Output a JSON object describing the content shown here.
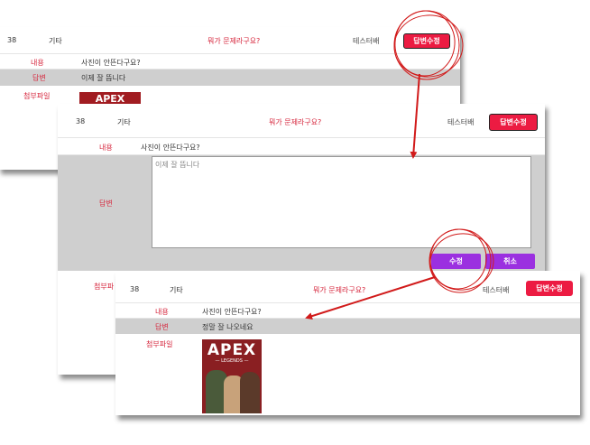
{
  "colors": {
    "accent_red": "#ec1b42",
    "label_red": "#d6243b",
    "submit_purple": "#9b30e0",
    "annotation_red": "#d11a1a"
  },
  "panel1": {
    "num": "38",
    "category": "기타",
    "title": "뭐가 문제라구요?",
    "author": "테스터배",
    "edit_btn": "답변수정",
    "content_label": "내용",
    "content": "사진이 안뜬다구요?",
    "answer_label": "답변",
    "answer": "이제 잘 뜹니다",
    "attach_label": "첨부파일",
    "image_text": "APEX"
  },
  "panel2": {
    "num": "38",
    "category": "기타",
    "title": "뭐가 문제라구요?",
    "author": "테스터배",
    "edit_btn": "답변수정",
    "content_label": "내용",
    "content": "사진이 안뜬다구요?",
    "answer_label": "답변",
    "answer_text": "이제 잘 뜹니다",
    "submit_btn": "수정",
    "cancel_btn": "취소",
    "attach_label": "첨부파"
  },
  "panel3": {
    "num": "38",
    "category": "기타",
    "title": "뭐가 문제라구요?",
    "author": "테스터배",
    "edit_btn": "답변수정",
    "content_label": "내용",
    "content": "사진이 안뜬다구요?",
    "answer_label": "답변",
    "answer": "정말 잘 나오네요",
    "attach_label": "첨부파일",
    "image_logo": "APEX",
    "image_sub": "— LEGENDS —"
  }
}
